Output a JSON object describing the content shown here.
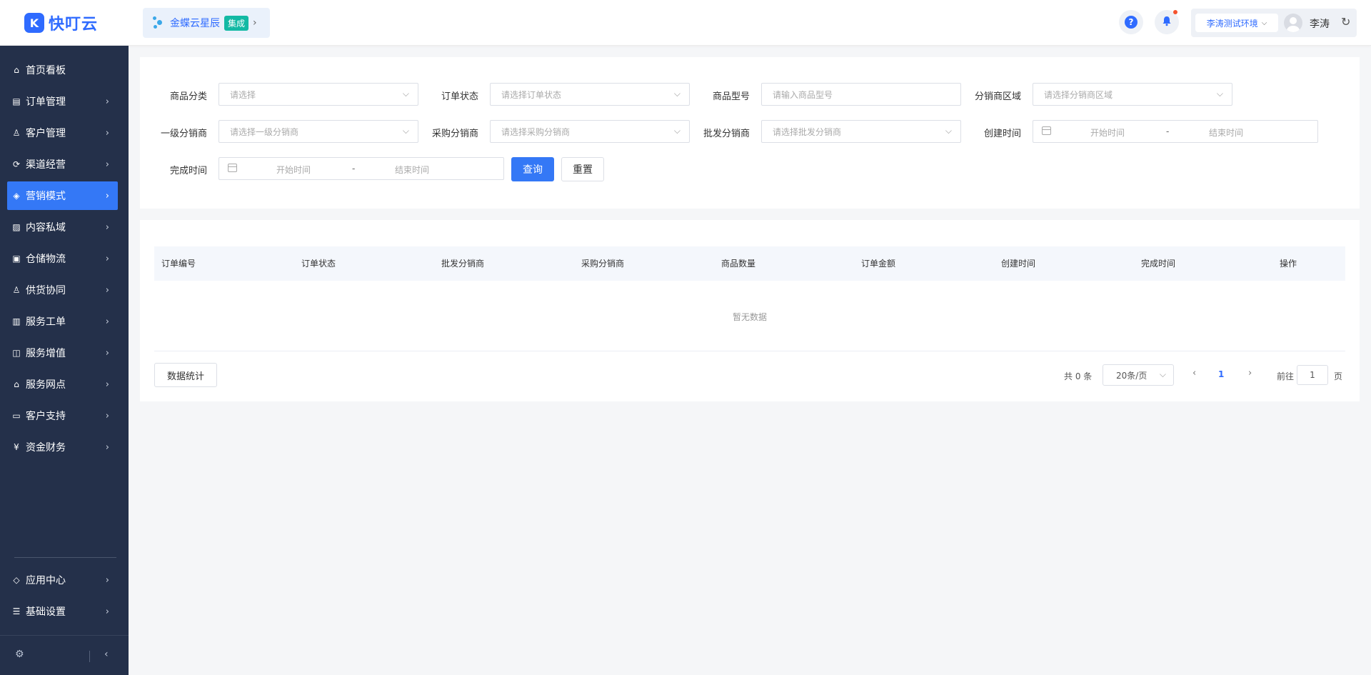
{
  "header": {
    "logo_text": "快叮云",
    "brand_name": "金蝶云星辰",
    "brand_tag": "集成",
    "env_label": "李涛测试环境",
    "username": "李涛"
  },
  "sidebar": {
    "items": [
      {
        "label": "首页看板",
        "icon": "home-icon",
        "has_arrow": false
      },
      {
        "label": "订单管理",
        "icon": "order-icon",
        "has_arrow": true
      },
      {
        "label": "客户管理",
        "icon": "user-icon",
        "has_arrow": true
      },
      {
        "label": "渠道经营",
        "icon": "channel-icon",
        "has_arrow": true
      },
      {
        "label": "营销模式",
        "icon": "tag-icon",
        "has_arrow": true,
        "active": true
      },
      {
        "label": "内容私域",
        "icon": "image-icon",
        "has_arrow": true
      },
      {
        "label": "仓储物流",
        "icon": "box-icon",
        "has_arrow": true
      },
      {
        "label": "供货协同",
        "icon": "supplier-icon",
        "has_arrow": true
      },
      {
        "label": "服务工单",
        "icon": "ticket-icon",
        "has_arrow": true
      },
      {
        "label": "服务增值",
        "icon": "bag-icon",
        "has_arrow": true
      },
      {
        "label": "服务网点",
        "icon": "store-icon",
        "has_arrow": true
      },
      {
        "label": "客户支持",
        "icon": "support-icon",
        "has_arrow": true
      },
      {
        "label": "资金财务",
        "icon": "yen-icon",
        "has_arrow": true
      }
    ],
    "bottom_items": [
      {
        "label": "应用中心",
        "icon": "cube-icon"
      },
      {
        "label": "基础设置",
        "icon": "settings-icon"
      }
    ]
  },
  "filters": {
    "product_category": {
      "label": "商品分类",
      "placeholder": "请选择"
    },
    "order_status": {
      "label": "订单状态",
      "placeholder": "请选择订单状态"
    },
    "product_model": {
      "label": "商品型号",
      "placeholder": "请输入商品型号"
    },
    "distributor_region": {
      "label": "分销商区域",
      "placeholder": "请选择分销商区域"
    },
    "first_level_distributor": {
      "label": "一级分销商",
      "placeholder": "请选择一级分销商"
    },
    "purchase_distributor": {
      "label": "采购分销商",
      "placeholder": "请选择采购分销商"
    },
    "wholesale_distributor": {
      "label": "批发分销商",
      "placeholder": "请选择批发分销商"
    },
    "create_time": {
      "label": "创建时间",
      "start": "开始时间",
      "end": "结束时间",
      "sep": "-"
    },
    "finish_time": {
      "label": "完成时间",
      "start": "开始时间",
      "end": "结束时间",
      "sep": "-"
    },
    "search_label": "查询",
    "reset_label": "重置"
  },
  "table": {
    "columns": [
      "订单编号",
      "订单状态",
      "批发分销商",
      "采购分销商",
      "商品数量",
      "订单金额",
      "创建时间",
      "完成时间",
      "操作"
    ],
    "empty_text": "暂无数据",
    "stats_label": "数据统计"
  },
  "pagination": {
    "total_text": "共 0 条",
    "page_size": "20条/页",
    "current_page": "1",
    "goto_label": "前往",
    "goto_value": "1",
    "page_unit": "页"
  },
  "colors": {
    "primary": "#3478f6",
    "sidebar_bg": "#24304a",
    "brand_tag": "#13b9a4"
  }
}
